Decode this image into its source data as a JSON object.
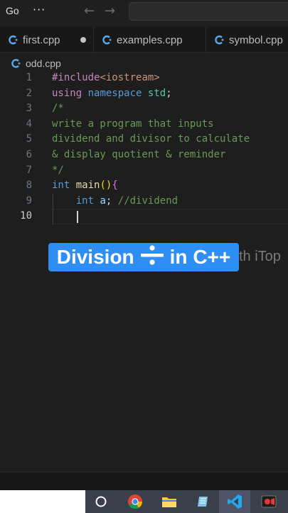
{
  "titlebar": {
    "menu_go": "Go",
    "menu_more": "···",
    "nav_back": "←",
    "nav_forward": "→"
  },
  "tabs": [
    {
      "label": "first.cpp",
      "modified": true
    },
    {
      "label": "examples.cpp",
      "modified": false
    },
    {
      "label": "symbol.cpp",
      "modified": false
    }
  ],
  "breadcrumb": {
    "file": "odd.cpp"
  },
  "editor": {
    "active_line": 10,
    "lines": [
      {
        "n": "1",
        "tokens": [
          [
            "kw-dir",
            "#include"
          ],
          [
            "kw-str",
            "<iostream>"
          ]
        ]
      },
      {
        "n": "2",
        "tokens": [
          [
            "kw-dir",
            "using"
          ],
          [
            "plain",
            " "
          ],
          [
            "kw",
            "namespace"
          ],
          [
            "plain",
            " "
          ],
          [
            "ns",
            "std"
          ],
          [
            "punc",
            ";"
          ]
        ]
      },
      {
        "n": "3",
        "tokens": [
          [
            "cm",
            "/*"
          ]
        ]
      },
      {
        "n": "4",
        "tokens": [
          [
            "cm",
            "write a program that inputs"
          ]
        ]
      },
      {
        "n": "5",
        "tokens": [
          [
            "cm",
            "dividend and divisor to calculate"
          ]
        ]
      },
      {
        "n": "6",
        "tokens": [
          [
            "cm",
            "& display quotient & reminder"
          ]
        ]
      },
      {
        "n": "7",
        "tokens": [
          [
            "cm",
            "*/"
          ]
        ]
      },
      {
        "n": "8",
        "tokens": [
          [
            "kw",
            "int"
          ],
          [
            "plain",
            " "
          ],
          [
            "fn",
            "main"
          ],
          [
            "brace-y",
            "()"
          ],
          [
            "brace",
            "{"
          ]
        ]
      },
      {
        "n": "9",
        "tokens": [
          [
            "plain",
            "    "
          ],
          [
            "kw",
            "int"
          ],
          [
            "plain",
            " "
          ],
          [
            "ident",
            "a"
          ],
          [
            "punc",
            ";"
          ],
          [
            "plain",
            " "
          ],
          [
            "cm",
            "//dividend"
          ]
        ]
      },
      {
        "n": "10",
        "tokens": []
      }
    ]
  },
  "overlay": {
    "title_left": "Division",
    "title_right": "in C++",
    "watermark": "th iTop"
  },
  "colors": {
    "accent": "#2f8ef3",
    "editor_bg": "#1e1e1e",
    "cpp_icon": "#5da8e8"
  },
  "taskbar": {
    "items": [
      "search-circle-icon",
      "chrome-icon",
      "file-explorer-icon",
      "notepad-icon",
      "vscode-icon",
      "screen-recorder-icon"
    ]
  }
}
